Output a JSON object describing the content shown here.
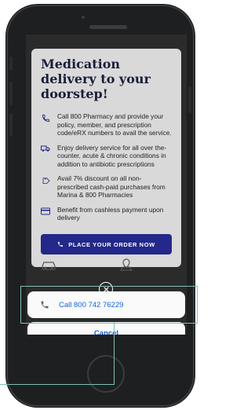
{
  "card": {
    "title": "Medication delivery to your doorstep!",
    "features": [
      {
        "icon": "phone-icon",
        "text": "Call 800 Pharmacy and provide your policy, member, and prescription code/eRX numbers to avail the service."
      },
      {
        "icon": "delivery-truck-icon",
        "text": "Enjoy delivery service for all over the-counter, acute & chronic conditions in addition to antibiotic prescriptions"
      },
      {
        "icon": "discount-tag-icon",
        "text": "Avail 7% discount on all non-prescribed cash-paid purchases from Marina & 800 Pharmacies"
      },
      {
        "icon": "card-icon",
        "text": "Benefit from cashless payment upon delivery"
      }
    ],
    "order_button_label": "PLACE YOUR ORDER NOW"
  },
  "sheet": {
    "call_label": "Call 800 742 76229",
    "cancel_label": "Cancel"
  },
  "colors": {
    "accent": "#23288a",
    "link": "#1565d8",
    "title": "#1a1e3a",
    "annotation": "#7fbfb6"
  }
}
